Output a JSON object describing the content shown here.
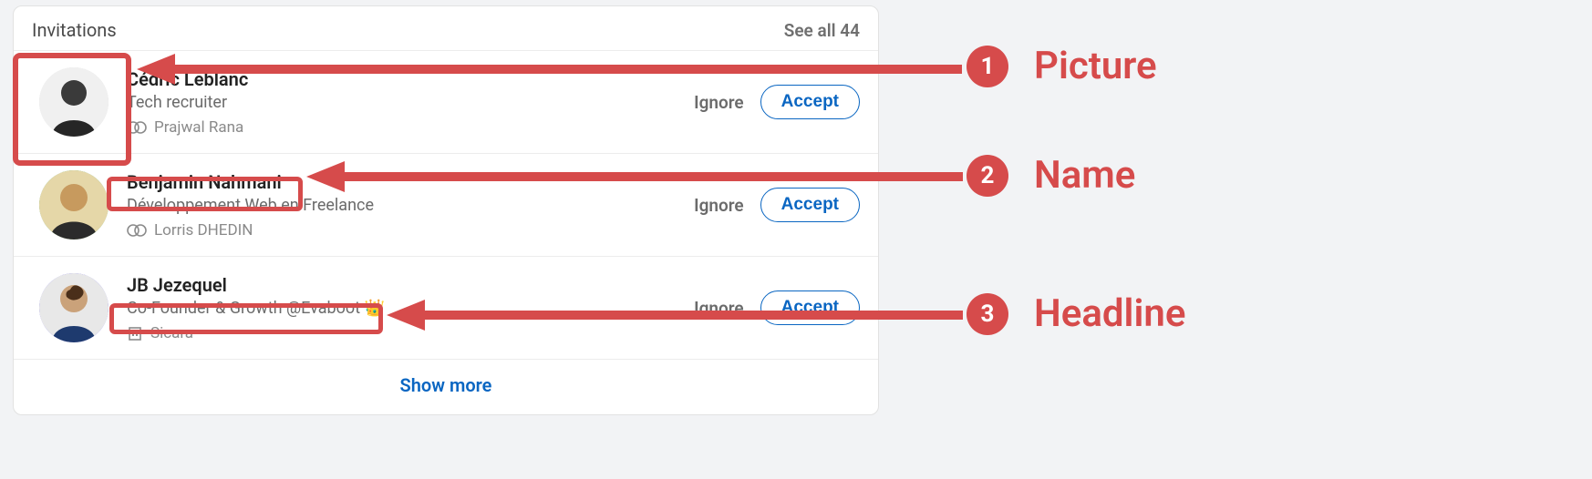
{
  "header": {
    "title": "Invitations",
    "see_all": "See all 44"
  },
  "actions": {
    "ignore": "Ignore",
    "accept": "Accept",
    "show_more": "Show more"
  },
  "invitations": [
    {
      "name": "Cédric Leblanc",
      "headline": "Tech recruiter",
      "mutual": "Prajwal Rana",
      "mutual_icon": "mutual-connections"
    },
    {
      "name": "Benjamin Nahmani",
      "headline": "Développement Web en Freelance",
      "mutual": "Lorris DHEDIN",
      "mutual_icon": "mutual-connections"
    },
    {
      "name": "JB Jezequel",
      "headline": "Co-Founder & Growth @Evaboot 👑",
      "mutual": "Sicara",
      "mutual_icon": "company"
    }
  ],
  "annotations": {
    "items": [
      {
        "num": "1",
        "label": "Picture"
      },
      {
        "num": "2",
        "label": "Name"
      },
      {
        "num": "3",
        "label": "Headline"
      }
    ],
    "color": "#d64b4b"
  }
}
